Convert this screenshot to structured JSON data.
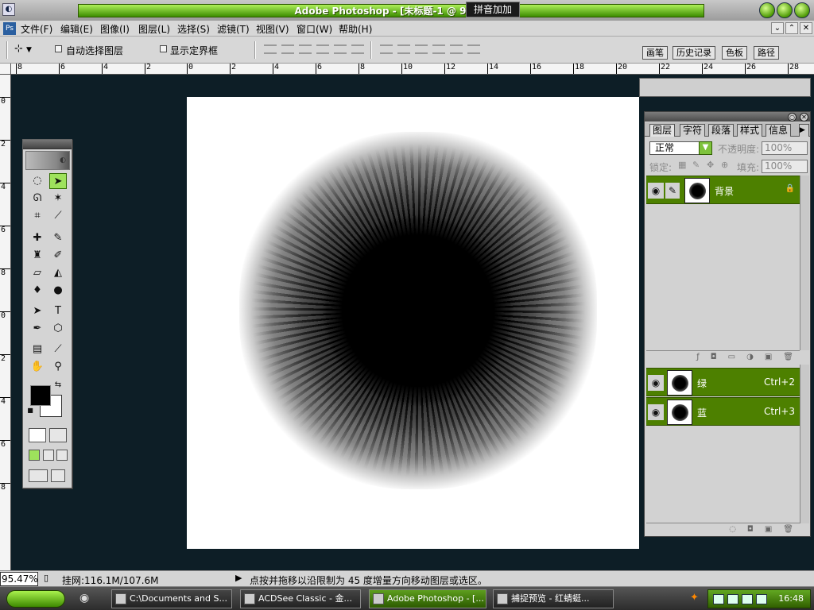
{
  "window": {
    "title": "Adobe Photoshop - [未标题-1 @ 95.5%(RGB",
    "ime_text": "拼音加加"
  },
  "menubar": {
    "items": [
      "文件(F)",
      "编辑(E)",
      "图像(I)",
      "图层(L)",
      "选择(S)",
      "滤镜(T)",
      "视图(V)",
      "窗口(W)",
      "帮助(H)"
    ]
  },
  "options": {
    "auto_select_label": "自动选择图层",
    "show_bounds_label": "显示定界框",
    "auto_select_checked": false,
    "show_bounds_checked": false
  },
  "palette_well": {
    "tabs": [
      "画笔",
      "历史记录",
      "色板",
      "路径"
    ]
  },
  "rulers": {
    "h": [
      "8",
      "6",
      "4",
      "2",
      "0",
      "2",
      "4",
      "6",
      "8",
      "10",
      "12",
      "14",
      "16",
      "18",
      "20",
      "22",
      "24",
      "26",
      "28"
    ],
    "v": [
      "0",
      "2",
      "4",
      "6",
      "8",
      "0",
      "2",
      "4",
      "6",
      "8"
    ]
  },
  "layers_panel": {
    "tabs": [
      "图层",
      "字符",
      "段落",
      "样式",
      "信息"
    ],
    "blend_mode": "正常",
    "opacity_label": "不透明度:",
    "opacity": "100%",
    "lock_label": "锁定:",
    "fill_label": "填充:",
    "fill": "100%",
    "layers": [
      {
        "name": "背景"
      }
    ],
    "channels": [
      {
        "name": "绿",
        "shortcut": "Ctrl+2"
      },
      {
        "name": "蓝",
        "shortcut": "Ctrl+3"
      }
    ]
  },
  "status": {
    "zoom": "95.47%",
    "doc_size": "挂网:116.1M/107.6M",
    "hint": "点按并拖移以沿限制为 45 度增量方向移动图层或选区。"
  },
  "taskbar": {
    "tasks": [
      "C:\\Documents and S...",
      "ACDSee Classic - 金...",
      "Adobe Photoshop - [...",
      "捕捉预览 - 红蜻蜓..."
    ],
    "clock": "16:48"
  }
}
